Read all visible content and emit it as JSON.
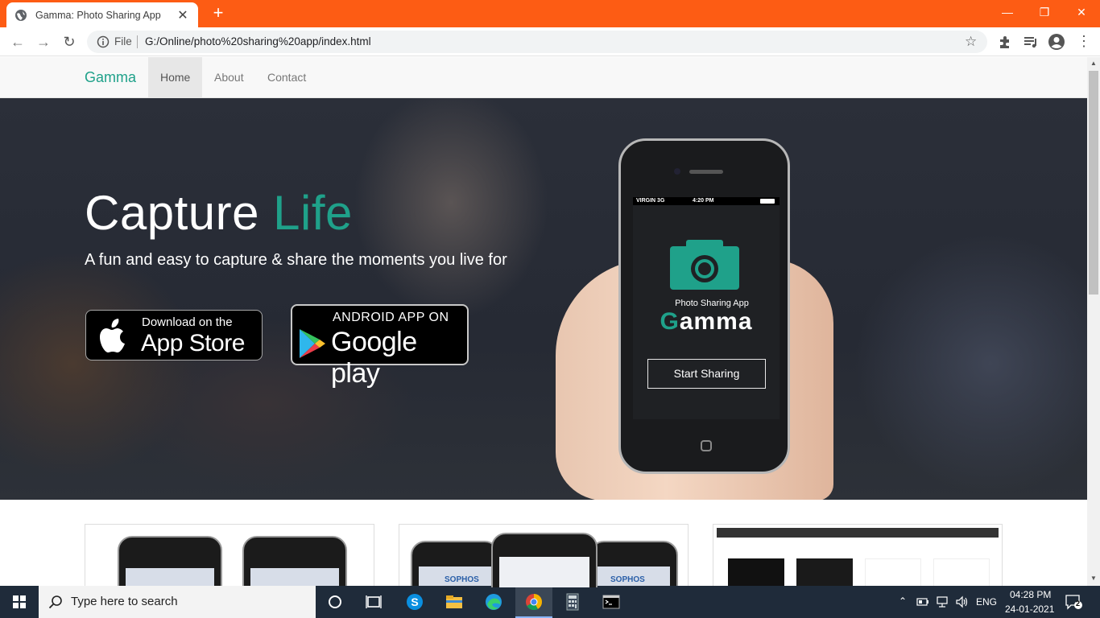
{
  "browser": {
    "tab_title": "Gamma: Photo Sharing App",
    "tab_close": "✕",
    "new_tab": "+",
    "url_scheme": "File",
    "url": "G:/Online/photo%20sharing%20app/index.html",
    "accent_color": "#fd5c14"
  },
  "nav": {
    "brand": "Gamma",
    "links": [
      "Home",
      "About",
      "Contact"
    ],
    "active": "Home"
  },
  "hero": {
    "title_part1": "Capture",
    "title_part2": "Life",
    "subtitle": "A fun and easy to capture & share the moments you live for",
    "appstore_small": "Download on the",
    "appstore_big": "App Store",
    "googleplay_small": "ANDROID APP ON",
    "googleplay_big": "Google play"
  },
  "phone": {
    "status_carrier": "VIRGIN  3G",
    "status_time": "4:20 PM",
    "app_tag": "Photo Sharing App",
    "app_name_first": "G",
    "app_name_rest": "amma",
    "start_button": "Start Sharing"
  },
  "thumbs": {
    "sophos1": "SOPHOS",
    "sophos2": "SOPHOS"
  },
  "taskbar": {
    "search_placeholder": "Type here to search",
    "lang": "ENG",
    "time": "04:28 PM",
    "date": "24-01-2021",
    "notifications": "2"
  },
  "colors": {
    "brand": "#1fa18a",
    "taskbar": "#1f2b3a"
  }
}
